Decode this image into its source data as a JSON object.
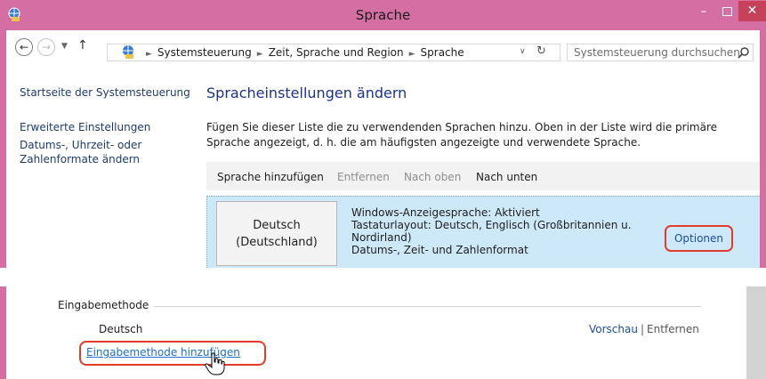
{
  "window": {
    "title": "Sprache",
    "minimize": "–",
    "close": "✕"
  },
  "address": {
    "back": "←",
    "forward": "→",
    "up": "↑",
    "crumbs": [
      "Systemsteuerung",
      "Zeit, Sprache und Region",
      "Sprache"
    ],
    "separator": "►",
    "dropdown": "∨",
    "refresh": "↻",
    "search_placeholder": "Systemsteuerung durchsuchen"
  },
  "sidebar": {
    "items": [
      {
        "label": "Startseite der Systemsteuerung"
      },
      {
        "label": "Erweiterte Einstellungen"
      },
      {
        "label": "Datums-, Uhrzeit- oder Zahlenformate ändern"
      }
    ]
  },
  "main": {
    "title": "Spracheinstellungen ändern",
    "description": "Fügen Sie dieser Liste die zu verwendenden Sprachen hinzu. Oben in der Liste wird die primäre Sprache angezeigt, d. h. die am häufigsten angezeigte und verwendete Sprache.",
    "toolbar": {
      "add": "Sprache hinzufügen",
      "remove": "Entfernen",
      "up": "Nach oben",
      "down": "Nach unten"
    },
    "language": {
      "name_line1": "Deutsch",
      "name_line2": "(Deutschland)",
      "info1": "Windows-Anzeigesprache: Aktiviert",
      "info2": "Tastaturlayout: Deutsch, Englisch (Großbritannien u. Nordirland)",
      "info3": "Datums-, Zeit- und Zahlenformat",
      "options": "Optionen"
    }
  },
  "input_methods": {
    "title": "Eingabemethode",
    "language": "Deutsch",
    "preview": "Vorschau",
    "separator": "|",
    "remove": "Entfernen",
    "add": "Eingabemethode hinzufügen"
  },
  "colors": {
    "titlebar": "#d56fa3",
    "close": "#c7415a",
    "highlight": "#e23c2a",
    "selected_row": "#cde8f8",
    "link": "#1e4f9a"
  }
}
